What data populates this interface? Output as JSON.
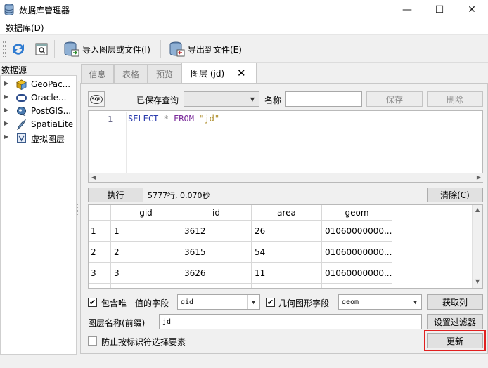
{
  "window": {
    "title": "数据库管理器",
    "minimize_glyph": "—",
    "maximize_glyph": "☐",
    "close_glyph": "✕"
  },
  "menu": {
    "database": "数据库(D)"
  },
  "toolbar": {
    "import_label": "导入图层或文件(I)",
    "export_label": "导出到文件(E)"
  },
  "browser": {
    "title": "数据源",
    "items": [
      {
        "label": "GeoPac...",
        "icon": "geopackage-icon"
      },
      {
        "label": "Oracle...",
        "icon": "oracle-icon"
      },
      {
        "label": "PostGIS...",
        "icon": "postgis-icon"
      },
      {
        "label": "SpatiaLite",
        "icon": "spatialite-icon"
      },
      {
        "label": "虚拟图层",
        "icon": "virtual-layer-icon"
      }
    ]
  },
  "tabs": [
    {
      "label": "信息",
      "active": false
    },
    {
      "label": "表格",
      "active": false
    },
    {
      "label": "预览",
      "active": false
    },
    {
      "label": "图层 (jd)",
      "active": true
    }
  ],
  "query": {
    "sql_button": "SQL",
    "saved_query_label": "已保存查询",
    "saved_query_value": "",
    "name_label": "名称",
    "name_value": "",
    "save_button": "保存",
    "delete_button": "删除",
    "line_number": "1",
    "sql": {
      "kw1": "SELECT",
      "star": " * ",
      "kw2": "FROM",
      "sp": " ",
      "table": "\"jd\""
    }
  },
  "execute": {
    "button": "执行",
    "status": "5777行, 0.070秒",
    "clear_button": "清除(C)"
  },
  "results": {
    "columns": [
      "gid",
      "id",
      "area",
      "geom"
    ],
    "rows": [
      {
        "num": "1",
        "cells": [
          "1",
          "3612",
          "26",
          "01060000000..."
        ]
      },
      {
        "num": "2",
        "cells": [
          "2",
          "3615",
          "54",
          "01060000000..."
        ]
      },
      {
        "num": "3",
        "cells": [
          "3",
          "3626",
          "11",
          "01060000000..."
        ]
      }
    ]
  },
  "layer_options": {
    "unique_field_label": "包含唯一值的字段",
    "unique_field_checked": true,
    "unique_field_value": "gid",
    "geom_field_label": "几何图形字段",
    "geom_field_checked": true,
    "geom_field_value": "geom",
    "retrieve_columns_button": "获取列",
    "layer_name_label": "图层名称(前缀)",
    "layer_name_value": "jd",
    "set_filter_button": "设置过滤器",
    "avoid_selecting_label": "防止按标识符选择要素",
    "avoid_selecting_checked": false,
    "update_button": "更新"
  },
  "colors": {
    "highlight": "#e02020"
  }
}
